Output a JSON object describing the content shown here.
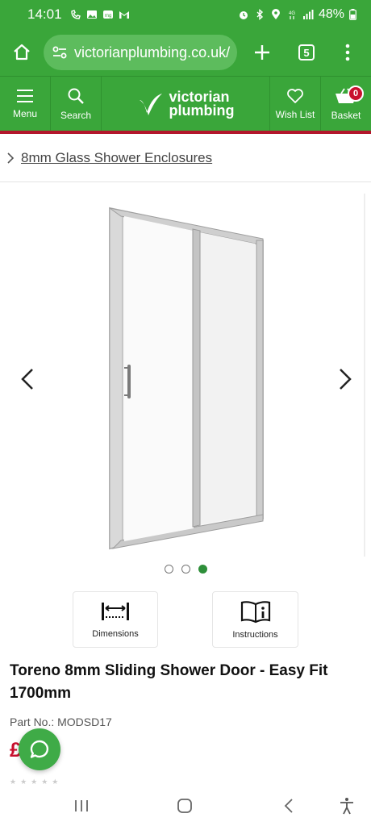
{
  "status_bar": {
    "time": "14:01",
    "left_icons": [
      "missed-call-icon",
      "gallery-icon",
      "badge-icon",
      "gmail-icon"
    ],
    "right_icons": [
      "alarm-icon",
      "bluetooth-icon",
      "location-icon",
      "network-4g-icon",
      "signal-icon"
    ],
    "battery_text": "48%"
  },
  "browser": {
    "url": "victorianplumbing.co.uk/",
    "tab_count": "5"
  },
  "site_header": {
    "menu_label": "Menu",
    "search_label": "Search",
    "logo_line1": "victorian",
    "logo_line2": "plumbing",
    "wishlist_label": "Wish List",
    "basket_label": "Basket",
    "basket_count": "0",
    "brand_color": "#3aa63a",
    "accent_red": "#b3162c"
  },
  "breadcrumb": {
    "label": "8mm Glass Shower Enclosures"
  },
  "gallery": {
    "image_alt": "Sliding shower door product image",
    "image_count": 3,
    "active_index": 3
  },
  "features": [
    {
      "label": "Dimensions",
      "icon": "dimensions-icon"
    },
    {
      "label": "Instructions",
      "icon": "instructions-icon"
    }
  ],
  "product": {
    "title": "Toreno 8mm Sliding Shower Door - Easy Fit 1700mm",
    "part_no": "Part No.: MODSD17",
    "price_visible": "£   .95",
    "rating_stars": "★★★★★"
  },
  "system_nav": [
    "recents-icon",
    "home-icon",
    "back-icon",
    "accessibility-icon"
  ]
}
